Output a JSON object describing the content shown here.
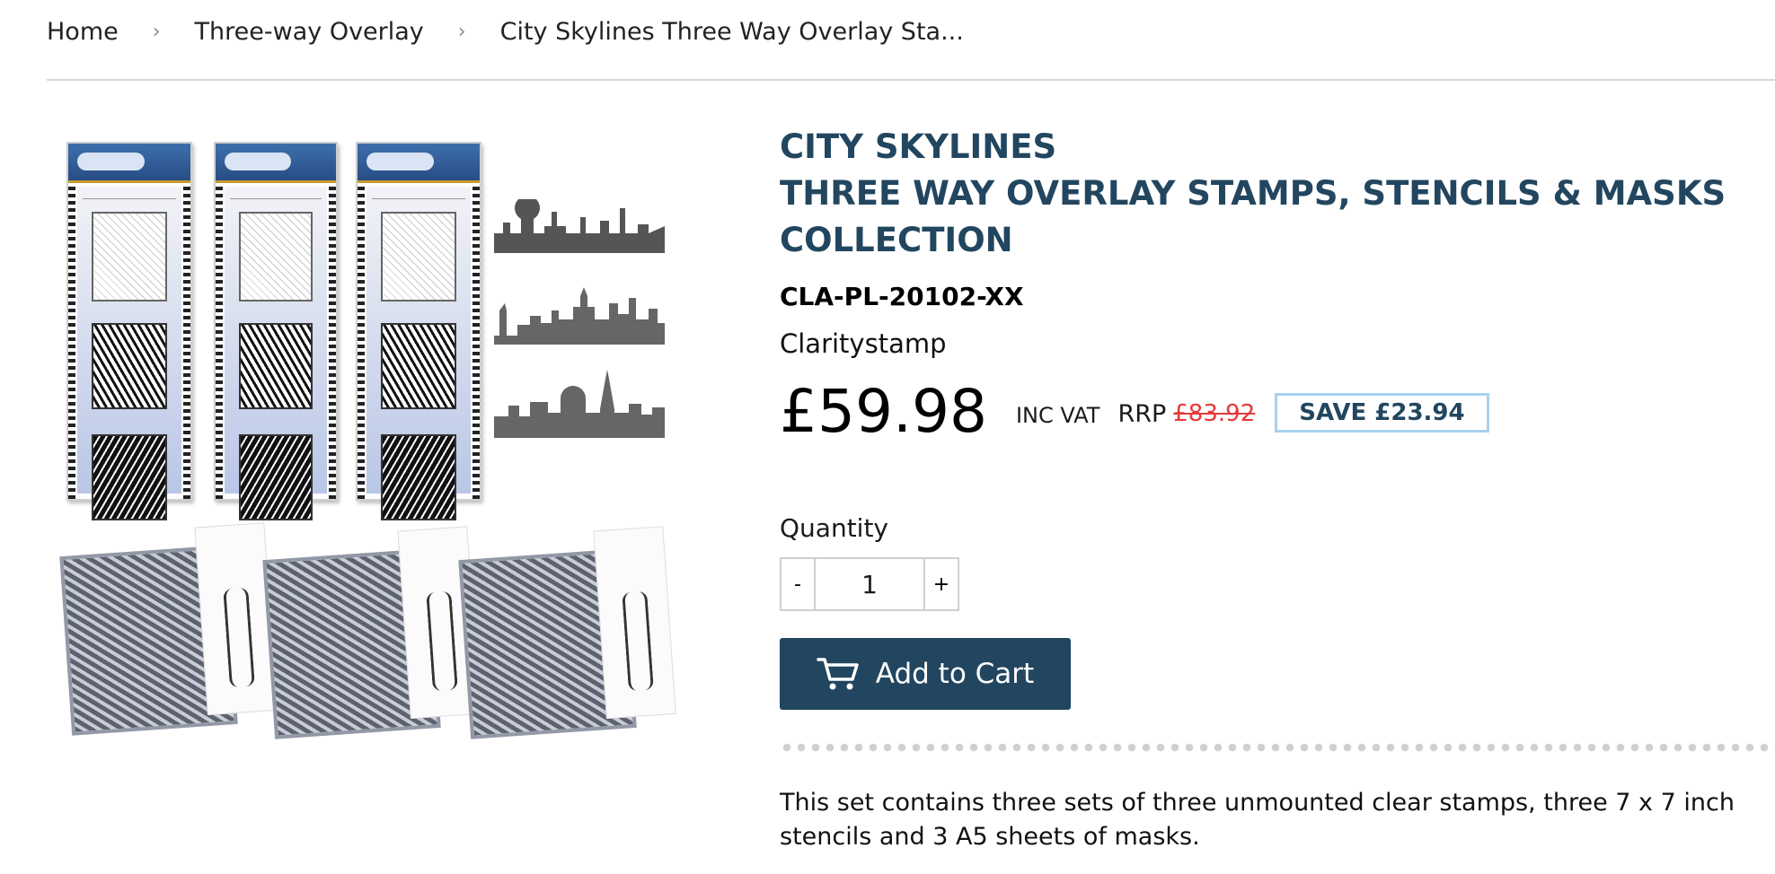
{
  "breadcrumb": {
    "items": [
      "Home",
      "Three-way Overlay",
      "City Skylines Three Way Overlay Sta..."
    ],
    "separator": "›"
  },
  "product": {
    "title_lines": [
      "CITY SKYLINES",
      "THREE WAY OVERLAY STAMPS, STENCILS & MASKS",
      "COLLECTION"
    ],
    "sku": "CLA-PL-20102-XX",
    "vendor": "Claritystamp",
    "price": "£59.98",
    "inc_vat": "INC VAT",
    "rrp_label": "RRP",
    "rrp_price": "£83.92",
    "save_label": "SAVE £23.94",
    "quantity_label": "Quantity",
    "quantity_minus": "-",
    "quantity_value": "1",
    "quantity_plus": "+",
    "add_to_cart": "Add to Cart",
    "description": "This set contains three sets of three unmounted clear stamps, three 7 x 7 inch stencils and 3 A5 sheets of masks."
  },
  "colors": {
    "brand": "#22465f",
    "sale_red": "#e23b3b",
    "save_border": "#a9d1ef"
  }
}
